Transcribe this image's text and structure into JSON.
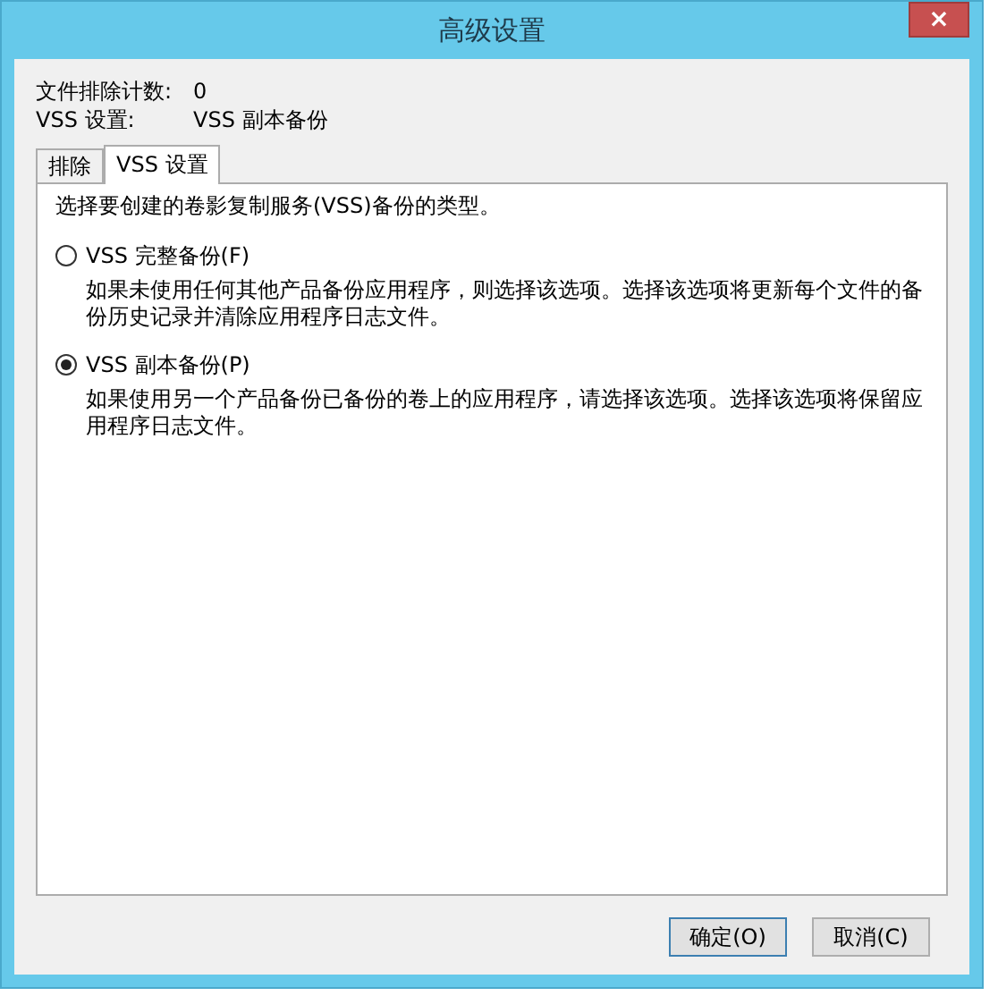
{
  "window": {
    "title": "高级设置",
    "close": "×"
  },
  "info": [
    {
      "label": "文件排除计数:",
      "value": "0"
    },
    {
      "label": "VSS 设置:",
      "value": "VSS 副本备份"
    }
  ],
  "tabs": [
    {
      "label": "排除",
      "selected": false
    },
    {
      "label": "VSS 设置",
      "selected": true
    }
  ],
  "panel": {
    "intro": "选择要创建的卷影复制服务(VSS)备份的类型。",
    "options": [
      {
        "label": "VSS 完整备份(F)",
        "selected": false,
        "description": "如果未使用任何其他产品备份应用程序，则选择该选项。选择该选项将更新每个文件的备份历史记录并清除应用程序日志文件。"
      },
      {
        "label": "VSS 副本备份(P)",
        "selected": true,
        "description": "如果使用另一个产品备份已备份的卷上的应用程序，请选择该选项。选择该选项将保留应用程序日志文件。"
      }
    ]
  },
  "buttons": [
    "确定(O)",
    "取消(C)"
  ]
}
